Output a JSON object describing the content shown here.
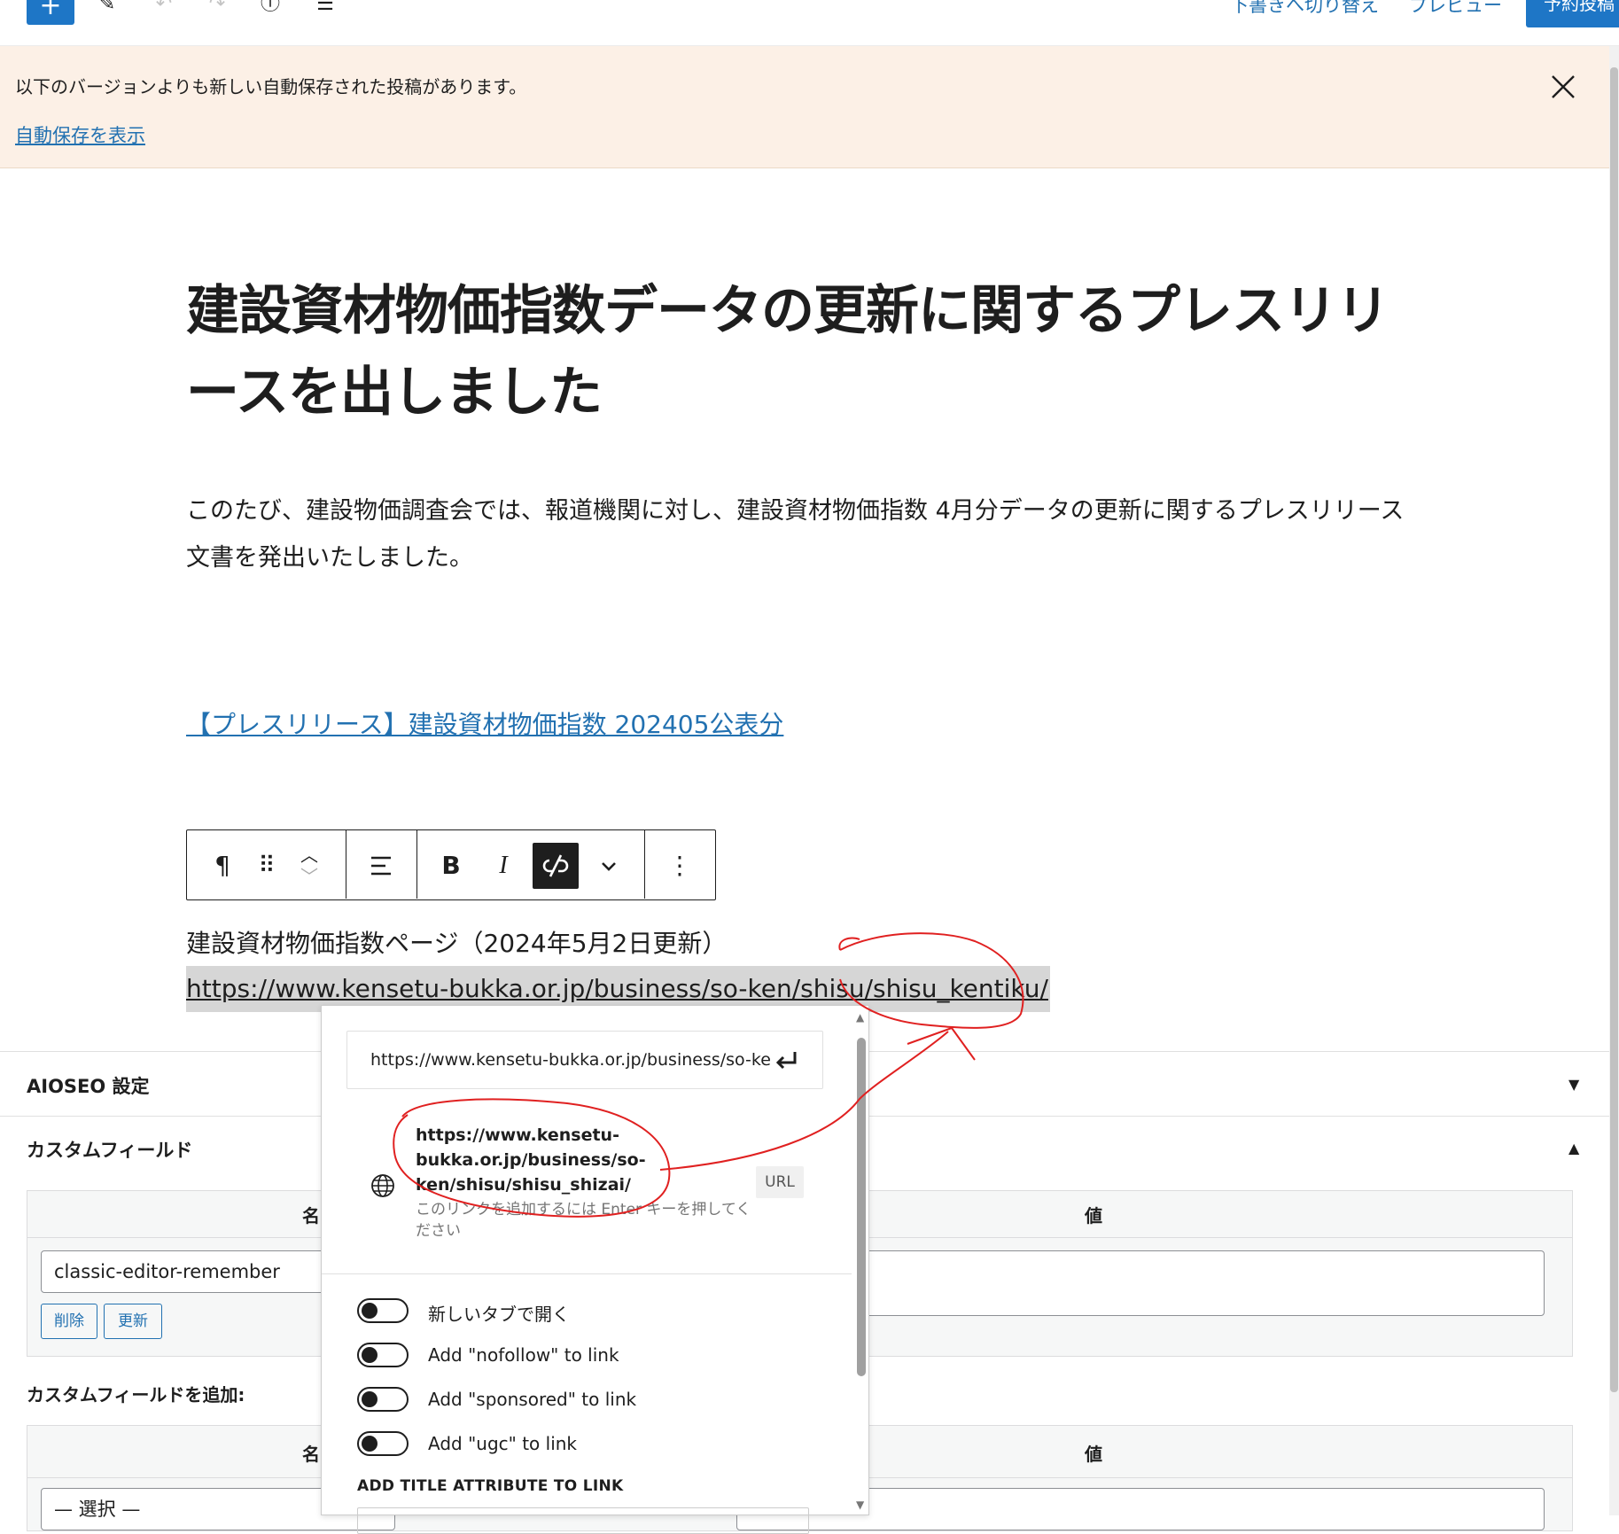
{
  "topbar": {
    "add_label": "+",
    "save_draft": "下書きへ切り替え",
    "preview": "プレビュー",
    "publish": "予約投稿"
  },
  "notice": {
    "message": "以下のバージョンよりも新しい自動保存された投稿があります。",
    "link": "自動保存を表示"
  },
  "post": {
    "title": "建設資材物価指数データの更新に関するプレスリリースを出しました",
    "paragraph": "このたび、建設物価調査会では、報道機関に対し、建設資材物価指数 4月分データの更新に関するプレスリリース文書を発出いたしました。",
    "press_link": "【プレスリリース】建設資材物価指数 202405公表分",
    "sub_heading": "建設資材物価指数ページ（2024年5月2日更新）",
    "selected_url": "https://www.kensetu-bukka.or.jp/business/so-ken/shisu/shisu_kentiku/"
  },
  "block_toolbar": {
    "paragraph": "¶",
    "drag": "⠿",
    "bold": "B",
    "italic": "I",
    "more": "⋮"
  },
  "link_popover": {
    "url_value": "https://www.kensetu-bukka.or.jp/business/so-ke",
    "suggestion": "https://www.kensetu-bukka.or.jp/business/so-ken/shisu/shisu_shizai/",
    "hint": "このリンクを追加するには Enter キーを押してください",
    "badge": "URL",
    "options": [
      {
        "label": "新しいタブで開く",
        "on": false
      },
      {
        "label": "Add \"nofollow\" to link",
        "on": false
      },
      {
        "label": "Add \"sponsored\" to link",
        "on": false
      },
      {
        "label": "Add \"ugc\" to link",
        "on": false
      }
    ],
    "title_attr_heading": "ADD TITLE ATTRIBUTE TO LINK"
  },
  "meta": {
    "aioseo": "AIOSEO 設定",
    "custom_fields": "カスタムフィールド",
    "name_header": "名",
    "value_header": "値",
    "field_name": "classic-editor-remember",
    "delete": "削除",
    "update": "更新",
    "add_heading": "カスタムフィールドを追加:",
    "select_placeholder": "— 選択 —"
  },
  "colors": {
    "accent": "#2271b1",
    "notice_bg": "#fcf0e6",
    "annotation": "#e02020"
  }
}
